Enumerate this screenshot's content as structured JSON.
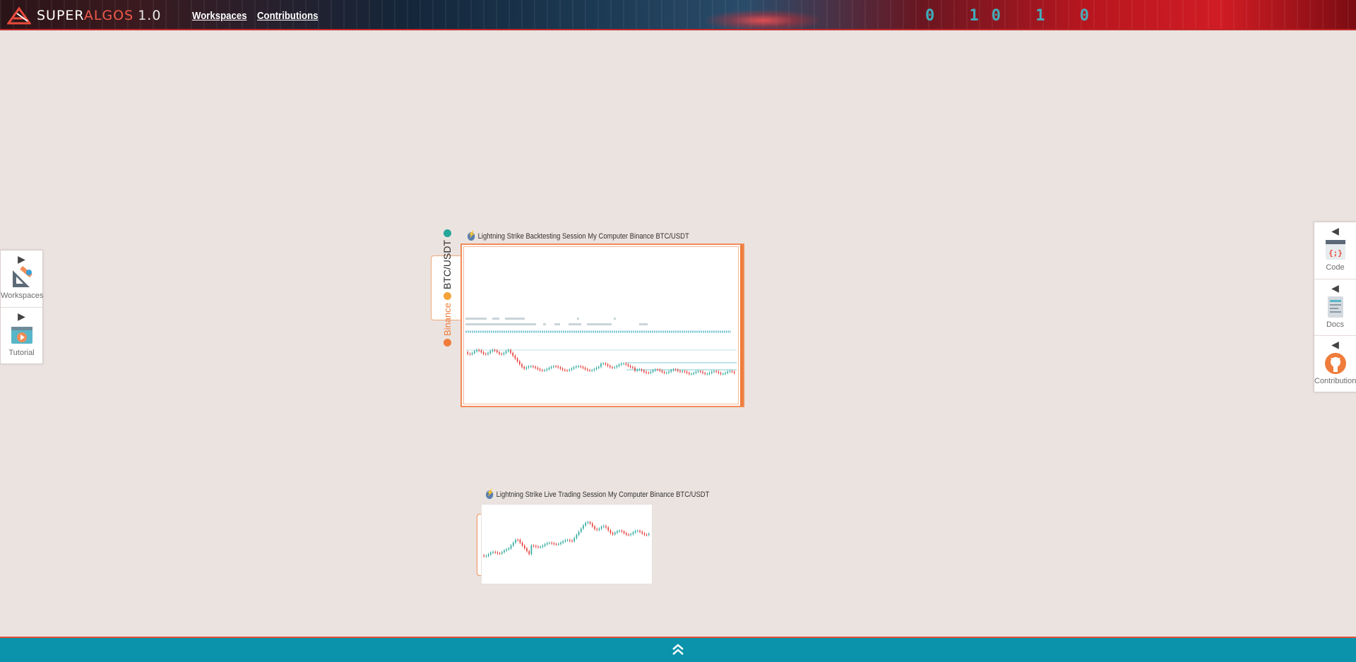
{
  "header": {
    "brand_prefix": "SUPER",
    "brand_suffix": "ALGOS",
    "version": "1.0",
    "nav": [
      {
        "label": "Workspaces"
      },
      {
        "label": "Contributions"
      }
    ],
    "binary_text": "0 10 1 0"
  },
  "left_dock": [
    {
      "label": "Workspaces",
      "icon": "workspaces-icon"
    },
    {
      "label": "Tutorial",
      "icon": "tutorial-icon"
    }
  ],
  "right_dock": [
    {
      "label": "Code",
      "icon": "code-icon"
    },
    {
      "label": "Docs",
      "icon": "docs-icon"
    },
    {
      "label": "Contributions",
      "icon": "github-icon"
    }
  ],
  "backtest_panel": {
    "title": "Lightning Strike Backtesting Session My Computer Binance BTC/USDT",
    "exchange": "Binance",
    "market": "BTC/USDT"
  },
  "live_panel": {
    "title": "Lightning Strike Live Trading Session My Computer Binance BTC/USDT"
  },
  "colors": {
    "canvas_bg": "#ebe3e0",
    "accent_orange": "#ef7c3a",
    "bottom_bar": "#0a93aa",
    "candle_up": "#26a69a",
    "candle_down": "#e53935"
  }
}
